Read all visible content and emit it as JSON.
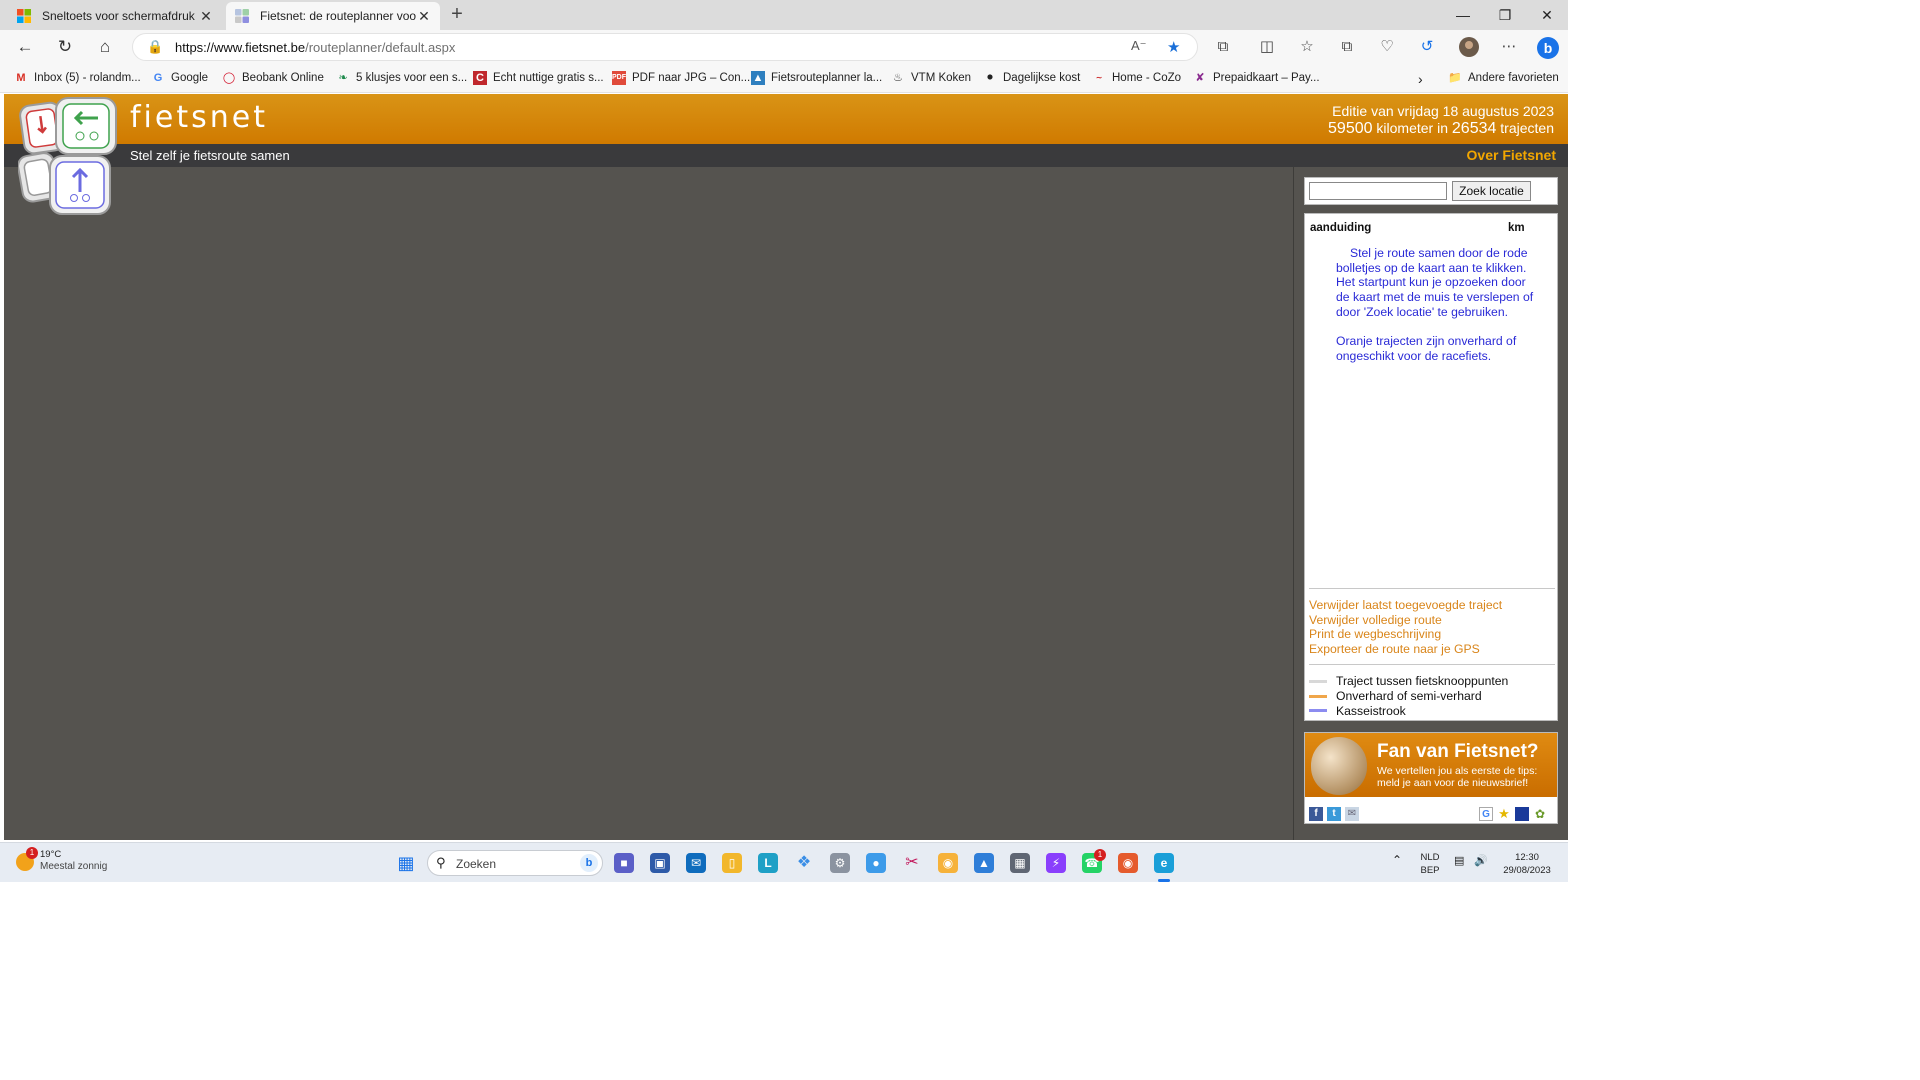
{
  "browser": {
    "tabs": [
      {
        "label": "Sneltoets voor schermafdruk - Mi",
        "favicon": "microsoft-icon",
        "active": false
      },
      {
        "label": "Fietsnet: de routeplanner voor de",
        "favicon": "fietsnet-icon",
        "active": true
      }
    ],
    "url_domain": "https://www.fietsnet.be",
    "url_path": "/routeplanner/default.aspx",
    "favorites": [
      {
        "label": "Inbox (5) - rolandm...",
        "icon": "gmail-icon"
      },
      {
        "label": "Google",
        "icon": "google-icon"
      },
      {
        "label": "Beobank Online",
        "icon": "beobank-icon"
      },
      {
        "label": "5 klusjes voor een s...",
        "icon": "leaf-icon"
      },
      {
        "label": "Echt nuttige gratis s...",
        "icon": "red-square-icon"
      },
      {
        "label": "PDF naar JPG – Con...",
        "icon": "pdf-icon"
      },
      {
        "label": "Fietsrouteplanner la...",
        "icon": "map-icon"
      },
      {
        "label": "VTM Koken",
        "icon": "chef-icon"
      },
      {
        "label": "Dagelijkse kost",
        "icon": "pan-icon"
      },
      {
        "label": "Home - CoZo",
        "icon": "cozo-icon"
      },
      {
        "label": "Prepaidkaart – Pay...",
        "icon": "payment-icon"
      }
    ],
    "other_favorites": "Andere favorieten"
  },
  "site": {
    "brand": "fietsnet",
    "edition_line": "Editie van vrijdag 18 augustus 2023",
    "km": "59500",
    "km_label": "kilometer in",
    "trajects": "26534",
    "trajects_label": "trajecten",
    "tagline": "Stel zelf je fietsroute samen",
    "about_link": "Over Fietsnet",
    "search_button": "Zoek locatie",
    "search_value": "",
    "col_name": "aanduiding",
    "col_km": "km",
    "info_1": "Stel je route samen door de rode bolletjes op de kaart aan te klikken.",
    "info_2": "Het startpunt kun je opzoeken door de kaart met de muis te verslepen of door 'Zoek locatie' te gebruiken.",
    "info_3": "Oranje trajecten zijn onverhard of ongeschikt voor de racefiets.",
    "actions": [
      "Verwijder laatst toegevoegde traject",
      "Verwijder volledige route",
      "Print de wegbeschrijving",
      "Exporteer de route naar je GPS"
    ],
    "legend": [
      {
        "label": "Traject tussen fietsknooppunten",
        "color": "#d8d8d8"
      },
      {
        "label": "Onverhard of semi-verhard",
        "color": "#f0a64a"
      },
      {
        "label": "Kasseistrook",
        "color": "#8c8cf0"
      }
    ],
    "fan_title": "Fan van Fietsnet?",
    "fan_sub": "We vertellen jou als eerste de tips: meld je aan voor de nieuwsbrief!",
    "colors": {
      "header_orange": "#d07a00",
      "link_blue": "#2a2ad6",
      "action_orange": "#d9851a",
      "map_bg": "#55534f"
    }
  },
  "taskbar": {
    "temp": "19°C",
    "weather": "Meestal zonnig",
    "weather_badge": "1",
    "search_placeholder": "Zoeken",
    "lang": "NLD",
    "layout": "BEP",
    "time": "12:30",
    "date": "29/08/2023",
    "whatsapp_badge": "1"
  }
}
